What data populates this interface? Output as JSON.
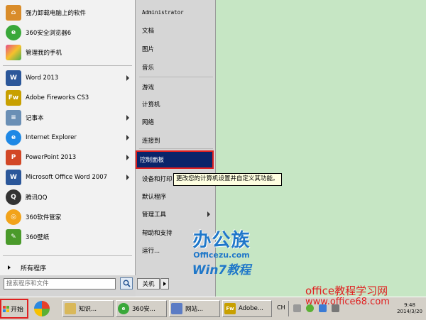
{
  "start_menu": {
    "pinned_items": [
      {
        "label": "强力卸载电脑上的软件",
        "icon": "uninstall-icon",
        "color": "#d98c2a"
      },
      {
        "label": "360安全浏览器6",
        "icon": "browser-360-icon",
        "color": "#3aa83a"
      },
      {
        "label": "管理我的手机",
        "icon": "phone-manager-icon",
        "color": "#e84d8a"
      }
    ],
    "recent_items": [
      {
        "label": "Word 2013",
        "icon": "word-icon",
        "color": "#2b579a",
        "glyph": "W",
        "submenu": true
      },
      {
        "label": "Adobe Fireworks CS3",
        "icon": "fireworks-icon",
        "color": "#c8a000",
        "glyph": "Fw",
        "submenu": false
      },
      {
        "label": "记事本",
        "icon": "notepad-icon",
        "color": "#6a8fb5",
        "glyph": "",
        "submenu": true
      },
      {
        "label": "Internet Explorer",
        "icon": "ie-icon",
        "color": "#1e88e5",
        "glyph": "e",
        "submenu": true
      },
      {
        "label": "PowerPoint 2013",
        "icon": "powerpoint-icon",
        "color": "#d24726",
        "glyph": "P",
        "submenu": true
      },
      {
        "label": "Microsoft Office Word 2007",
        "icon": "word2007-icon",
        "color": "#2b579a",
        "glyph": "W",
        "submenu": true
      },
      {
        "label": "腾讯QQ",
        "icon": "qq-icon",
        "color": "#333333",
        "glyph": "",
        "submenu": false
      },
      {
        "label": "360软件管家",
        "icon": "software-manager-icon",
        "color": "#f2a31a",
        "glyph": "",
        "submenu": false
      },
      {
        "label": "360壁纸",
        "icon": "wallpaper-icon",
        "color": "#4a9a2a",
        "glyph": "",
        "submenu": false
      }
    ],
    "all_programs": "所有程序",
    "search": {
      "placeholder": "搜索程序和文件"
    },
    "right_items": [
      {
        "label": "Administrator",
        "submenu": false
      },
      {
        "label": "文档",
        "submenu": false
      },
      {
        "label": "图片",
        "submenu": false
      },
      {
        "label": "音乐",
        "submenu": false
      },
      {
        "label": "游戏",
        "submenu": false
      },
      {
        "label": "计算机",
        "submenu": false
      },
      {
        "label": "网络",
        "submenu": false
      },
      {
        "label": "连接到",
        "submenu": false
      },
      {
        "label": "控制面板",
        "submenu": false,
        "selected": true
      },
      {
        "label": "设备和打印",
        "submenu": false
      },
      {
        "label": "默认程序",
        "submenu": false
      },
      {
        "label": "管理工具",
        "submenu": true
      },
      {
        "label": "帮助和支持",
        "submenu": false
      },
      {
        "label": "运行...",
        "submenu": false
      }
    ],
    "shutdown_label": "关机",
    "tooltip": "更改您的计算机设置并自定义其功能。"
  },
  "taskbar": {
    "start_label": "开始",
    "buttons": [
      {
        "label": "",
        "icon": "library-icon",
        "color": "#f0a020"
      },
      {
        "label": "知识...",
        "icon": "folder-icon",
        "color": "#d9b85a"
      },
      {
        "label": "360安...",
        "icon": "browser-360-icon",
        "color": "#3aa83a"
      },
      {
        "label": "网站...",
        "icon": "website-icon",
        "color": "#5c7cc4"
      },
      {
        "label": "Adobe...",
        "icon": "fireworks-icon",
        "color": "#c8a000"
      }
    ],
    "language": "CH",
    "time": "9:48",
    "date": "2014/3/20"
  },
  "watermarks": {
    "brand": "办公族",
    "site": "Officezu.com",
    "win7": "Win7教程",
    "office_title": "office教程学习网",
    "office_url": "www.office68.com"
  },
  "colors": {
    "desktop": "#c6e6c4",
    "selection": "#0a246a",
    "highlight_box": "#e02020",
    "watermark_blue": "#1f77c9"
  }
}
